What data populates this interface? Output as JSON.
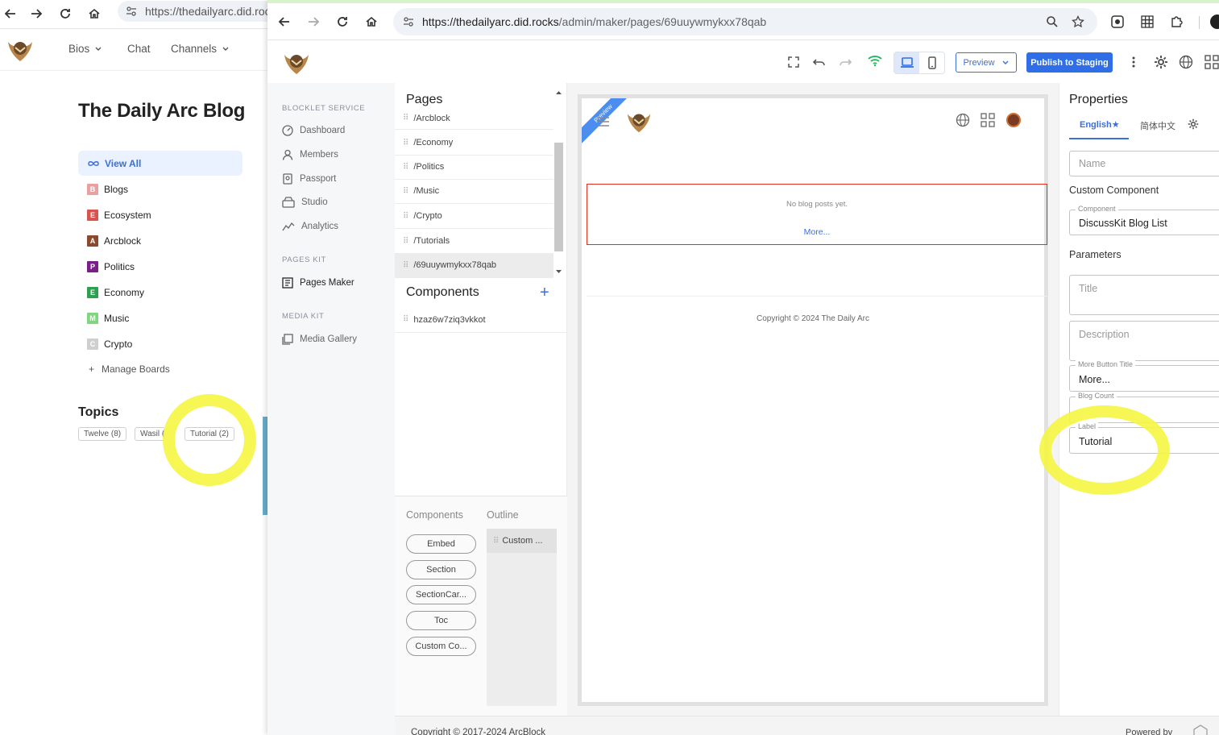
{
  "background_window": {
    "url": "https://thedailyarc.did.rocks",
    "nav": [
      {
        "label": "Bios",
        "dropdown": true
      },
      {
        "label": "Chat",
        "dropdown": false
      },
      {
        "label": "Channels",
        "dropdown": true
      }
    ],
    "blog_title": "The Daily Arc Blog",
    "view_all": "View All",
    "boards": [
      {
        "letter": "B",
        "label": "Blogs",
        "color": "#e8a0a0"
      },
      {
        "letter": "E",
        "label": "Ecosystem",
        "color": "#d9534f"
      },
      {
        "letter": "A",
        "label": "Arcblock",
        "color": "#8b4a2b"
      },
      {
        "letter": "P",
        "label": "Politics",
        "color": "#7a1f8a"
      },
      {
        "letter": "E",
        "label": "Economy",
        "color": "#2e9e4f"
      },
      {
        "letter": "M",
        "label": "Music",
        "color": "#7fd67f"
      },
      {
        "letter": "C",
        "label": "Crypto",
        "color": "#cfcfcf"
      }
    ],
    "manage_boards": "Manage Boards",
    "topics_title": "Topics",
    "topics": [
      "Twelve (8)",
      "Wasil (",
      "Tutorial (2)"
    ]
  },
  "browser": {
    "url_domain": "https://thedailyarc.did.rocks",
    "url_path": "/admin/maker/pages/69uuywmykxx78qab"
  },
  "toolbar": {
    "preview_label": "Preview",
    "publish_label": "Publish to Staging"
  },
  "sidebar": {
    "sections": [
      {
        "title": "BLOCKLET SERVICE",
        "items": [
          "Dashboard",
          "Members",
          "Passport",
          "Studio",
          "Analytics"
        ]
      },
      {
        "title": "PAGES KIT",
        "items": [
          "Pages Maker"
        ]
      },
      {
        "title": "MEDIA KIT",
        "items": [
          "Media Gallery"
        ]
      }
    ]
  },
  "pages_panel": {
    "title": "Pages",
    "pages": [
      "/Arcblock",
      "/Economy",
      "/Politics",
      "/Music",
      "/Crypto",
      "/Tutorials",
      "/69uuywmykxx78qab"
    ],
    "active_index": 6
  },
  "components_panel": {
    "title": "Components",
    "add_label": "+",
    "items": [
      "hzaz6w7ziq3vkkot"
    ]
  },
  "library": {
    "tabs": [
      "Components",
      "Outline"
    ],
    "chips": [
      "Embed",
      "Section",
      "SectionCar...",
      "Toc",
      "Custom Co..."
    ],
    "outline_items": [
      "Custom ..."
    ]
  },
  "canvas": {
    "ribbon_label": "Preview",
    "no_posts": "No blog posts yet.",
    "more_link": "More...",
    "copyright": "Copyright © 2024 The Daily Arc"
  },
  "footer": {
    "left": "Copyright © 2017-2024  ArcBlock",
    "right": "Powered by"
  },
  "properties": {
    "title": "Properties",
    "lang_tabs": [
      "English★",
      "简体中文"
    ],
    "name_placeholder": "Name",
    "custom_component_heading": "Custom Component",
    "component_legend": "Component",
    "component_value": "DiscussKit Blog List",
    "parameters_heading": "Parameters",
    "title_placeholder": "Title",
    "description_placeholder": "Description",
    "more_button_legend": "More Button Title",
    "more_button_value": "More...",
    "blog_count_legend": "Blog Count",
    "label_legend": "Label",
    "label_value": "Tutorial"
  },
  "colors": {
    "accent": "#2f6ee6",
    "highlight": "#f5f542",
    "error_border": "#e0301e"
  }
}
